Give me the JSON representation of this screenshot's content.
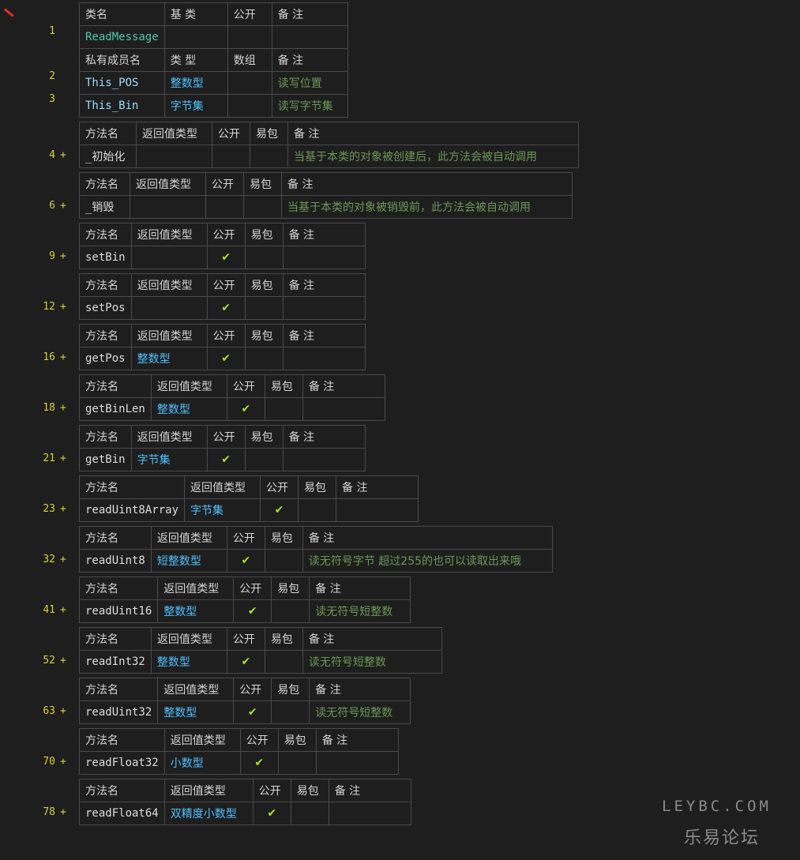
{
  "class_table": {
    "header": [
      "类名",
      "基 类",
      "公开",
      "备 注"
    ],
    "class_name": "ReadMessage",
    "member_header": [
      "私有成员名",
      "类 型",
      "数组",
      "备 注"
    ],
    "members": [
      {
        "name": "This_POS",
        "type": "整数型",
        "comment": "读写位置"
      },
      {
        "name": "This_Bin",
        "type": "字节集",
        "comment": "读写字节集"
      }
    ],
    "line_numbers": [
      "1",
      "2",
      "3"
    ]
  },
  "method_header": [
    "方法名",
    "返回值类型",
    "公开",
    "易包",
    "备 注"
  ],
  "fold_marker": "+",
  "check_glyph": "✔",
  "methods": [
    {
      "line": "4",
      "name": "_初始化",
      "ret": "",
      "public": false,
      "comment": "当基于本类的对象被创建后，此方法会被自动调用"
    },
    {
      "line": "6",
      "name": "_销毁",
      "ret": "",
      "public": false,
      "comment": "当基于本类的对象被销毁前，此方法会被自动调用"
    },
    {
      "line": "9",
      "name": "setBin",
      "ret": "",
      "public": true,
      "comment": ""
    },
    {
      "line": "12",
      "name": "setPos",
      "ret": "",
      "public": true,
      "comment": ""
    },
    {
      "line": "16",
      "name": "getPos",
      "ret": "整数型",
      "public": true,
      "comment": ""
    },
    {
      "line": "18",
      "name": "getBinLen",
      "ret": "整数型",
      "public": true,
      "comment": ""
    },
    {
      "line": "21",
      "name": "getBin",
      "ret": "字节集",
      "public": true,
      "comment": ""
    },
    {
      "line": "23",
      "name": "readUint8Array",
      "ret": "字节集",
      "public": true,
      "comment": ""
    },
    {
      "line": "32",
      "name": "readUint8",
      "ret": "短整数型",
      "public": true,
      "comment": "读无符号字节  超过255的也可以读取出来哦"
    },
    {
      "line": "41",
      "name": "readUint16",
      "ret": "整数型",
      "public": true,
      "comment": "读无符号短整数"
    },
    {
      "line": "52",
      "name": "readInt32",
      "ret": "整数型",
      "public": true,
      "comment": "读无符号短整数"
    },
    {
      "line": "63",
      "name": "readUint32",
      "ret": "整数型",
      "public": true,
      "comment": "读无符号短整数"
    },
    {
      "line": "70",
      "name": "readFloat32",
      "ret": "小数型",
      "public": true,
      "comment": ""
    },
    {
      "line": "78",
      "name": "readFloat64",
      "ret": "双精度小数型",
      "public": true,
      "comment": ""
    }
  ],
  "watermark": {
    "latin": "LEYBC.COM",
    "chinese": "乐易论坛"
  },
  "colors": {
    "background": "#1e1e1e",
    "line_number": "#d7d038",
    "class_name": "#4ec9b0",
    "member_name": "#9cdcfe",
    "type": "#4fc1ff",
    "comment": "#6a9955",
    "check": "#a6e22e",
    "border": "#4a4a4a"
  }
}
